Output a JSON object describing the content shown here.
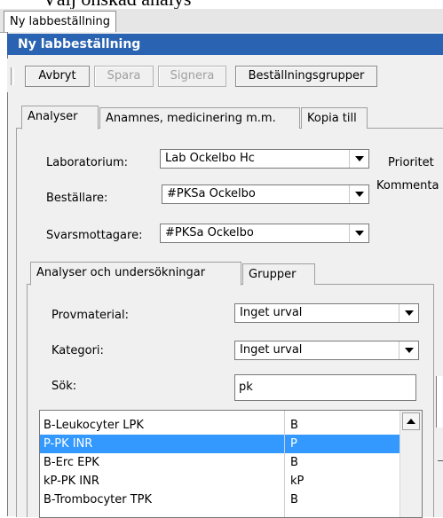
{
  "document_heading": "Välj önskad analys",
  "window_tab": "Ny labbeställning",
  "title": "Ny labbeställning",
  "toolbar": {
    "cancel": "Avbryt",
    "save": "Spara",
    "sign": "Signera",
    "order_groups": "Beställningsgrupper"
  },
  "main_tabs": [
    "Analyser",
    "Anamnes, medicinering m.m.",
    "Kopia till"
  ],
  "laboratory": {
    "label": "Laboratorium:",
    "value": "Lab Ockelbo Hc"
  },
  "orderer": {
    "label": "Beställare:",
    "value": "#PKSa Ockelbo"
  },
  "recipient": {
    "label": "Svarsmottagare:",
    "value": "#PKSa Ockelbo"
  },
  "priority_label": "Prioritet",
  "comment_label": "Kommenta",
  "sub_tabs": [
    "Analyser och undersökningar",
    "Grupper"
  ],
  "specimen": {
    "label": "Provmaterial:",
    "value": "Inget urval"
  },
  "category": {
    "label": "Kategori:",
    "value": "Inget urval"
  },
  "search": {
    "label": "Sök:",
    "value": "pk"
  },
  "results": [
    {
      "name": "B-Leukocyter LPK",
      "material": "B",
      "selected": false
    },
    {
      "name": "P-PK INR",
      "material": "P",
      "selected": true
    },
    {
      "name": "B-Erc EPK",
      "material": "B",
      "selected": false
    },
    {
      "name": "kP-PK INR",
      "material": "kP",
      "selected": false
    },
    {
      "name": "B-Trombocyter TPK",
      "material": "B",
      "selected": false
    }
  ],
  "colors": {
    "titlebar": "#2a63b1",
    "selection": "#3399ff",
    "window_bg": "#f0f0f0"
  }
}
